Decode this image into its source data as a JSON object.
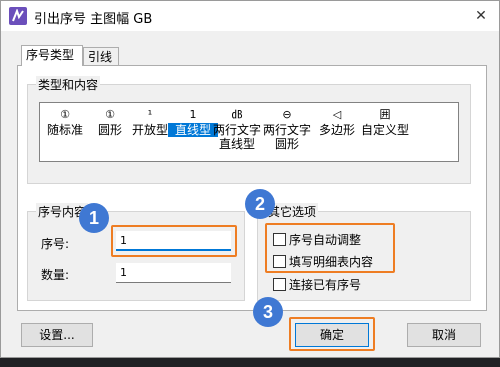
{
  "window": {
    "title": "引出序号 主图幅 GB",
    "close_glyph": "✕"
  },
  "tabs": [
    {
      "label": "序号类型"
    },
    {
      "label": "引线"
    }
  ],
  "type_group": {
    "label": "类型和内容",
    "items": [
      {
        "glyph": "①",
        "label": "随标准"
      },
      {
        "glyph": "①",
        "label": "圆形"
      },
      {
        "glyph": "¹",
        "label": "开放型"
      },
      {
        "glyph": "1",
        "label": "直线型"
      },
      {
        "glyph": "㏈",
        "label": "两行文字",
        "label2": "直线型"
      },
      {
        "glyph": "⊖",
        "label": "两行文字",
        "label2": "圆形"
      },
      {
        "glyph": "◁",
        "label": "多边形"
      },
      {
        "glyph": "囲",
        "label": "自定义型"
      }
    ],
    "selected_index": 3
  },
  "content_group": {
    "label": "序号内容",
    "number_label": "序号:",
    "number_value": "1",
    "qty_label": "数量:",
    "qty_value": "1"
  },
  "options_group": {
    "label": "其它选项",
    "options": [
      {
        "label": "序号自动调整",
        "checked": false
      },
      {
        "label": "填写明细表内容",
        "checked": false
      },
      {
        "label": "连接已有序号",
        "checked": false
      }
    ]
  },
  "buttons": {
    "settings": "设置...",
    "ok": "确定",
    "cancel": "取消"
  },
  "annotations": {
    "badge1": "1",
    "badge2": "2",
    "badge3": "3"
  },
  "colors": {
    "highlight": "#ee7d23",
    "badge": "#3f78d3",
    "accent": "#0078d7"
  }
}
